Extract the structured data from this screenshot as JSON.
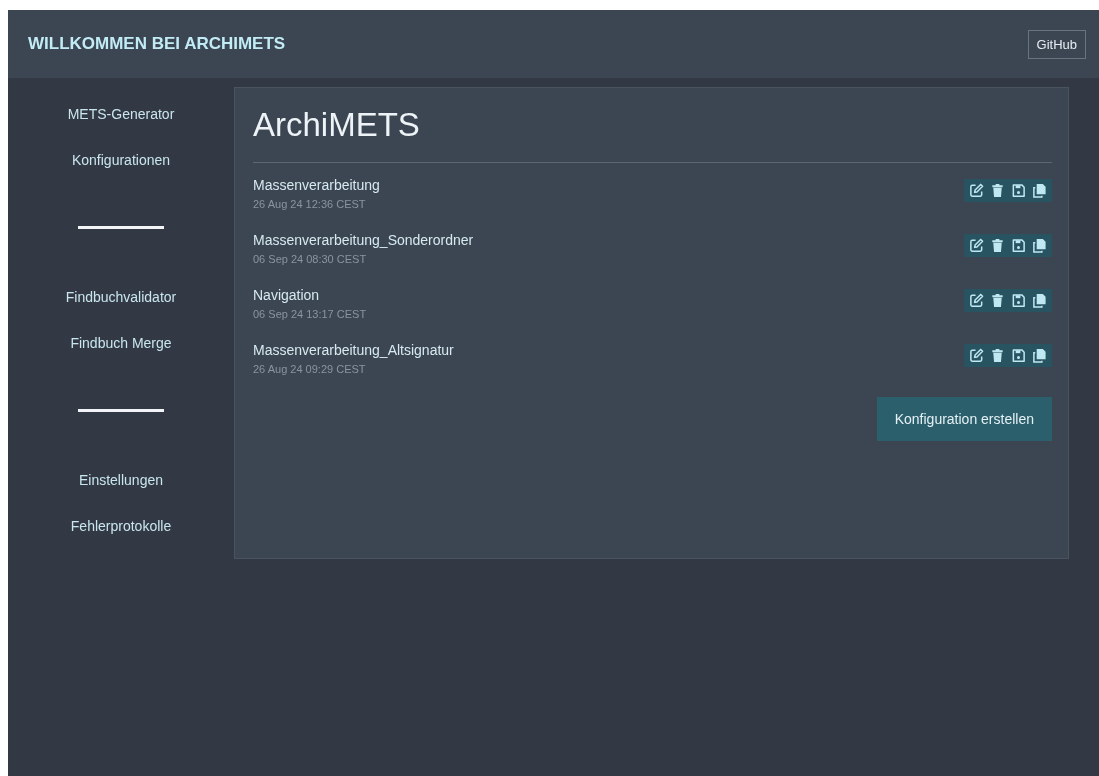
{
  "header": {
    "title": "WILLKOMMEN BEI ARCHIMETS",
    "github_button": "GitHub"
  },
  "sidebar": {
    "groups": [
      {
        "items": [
          {
            "label": "METS-Generator"
          },
          {
            "label": "Konfigurationen"
          }
        ]
      },
      {
        "items": [
          {
            "label": "Findbuchvalidator"
          },
          {
            "label": "Findbuch Merge"
          }
        ]
      },
      {
        "items": [
          {
            "label": "Einstellungen"
          },
          {
            "label": "Fehlerprotokolle"
          }
        ]
      }
    ]
  },
  "main": {
    "title": "ArchiMETS",
    "configurations": [
      {
        "name": "Massenverarbeitung",
        "date": "26 Aug 24 12:36 CEST"
      },
      {
        "name": "Massenverarbeitung_Sonderordner",
        "date": "06 Sep 24 08:30 CEST"
      },
      {
        "name": "Navigation",
        "date": "06 Sep 24 13:17 CEST"
      },
      {
        "name": "Massenverarbeitung_Altsignatur",
        "date": "26 Aug 24 09:29 CEST"
      }
    ],
    "create_button": "Konfiguration erstellen"
  }
}
